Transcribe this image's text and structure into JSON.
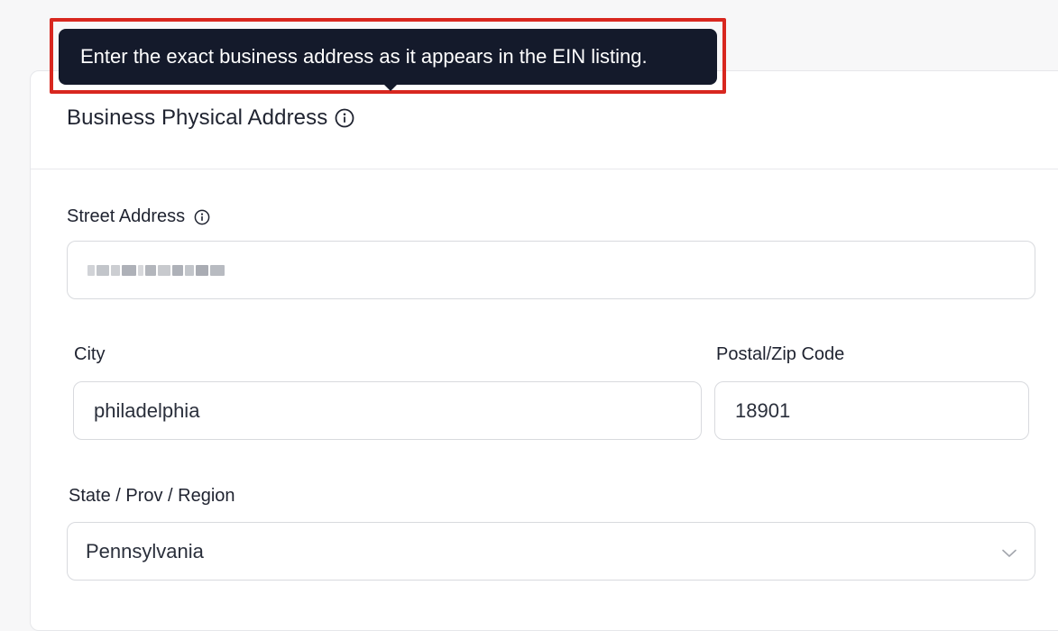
{
  "tooltip": {
    "text": "Enter the exact business address as it appears in the EIN listing."
  },
  "section": {
    "title": "Business Physical Address",
    "info_icon": "info-circle-icon"
  },
  "fields": {
    "street": {
      "label": "Street Address",
      "info_icon": "info-circle-icon",
      "value_redacted": true
    },
    "city": {
      "label": "City",
      "value": "philadelphia"
    },
    "postal": {
      "label": "Postal/Zip Code",
      "value": "18901"
    },
    "state": {
      "label": "State / Prov / Region",
      "value": "Pennsylvania",
      "chevron_icon": "chevron-down-icon"
    }
  },
  "colors": {
    "tooltip_bg": "#141a2b",
    "highlight_border": "#d8271f",
    "input_border": "#d8dade",
    "page_bg": "#f7f7f8"
  }
}
